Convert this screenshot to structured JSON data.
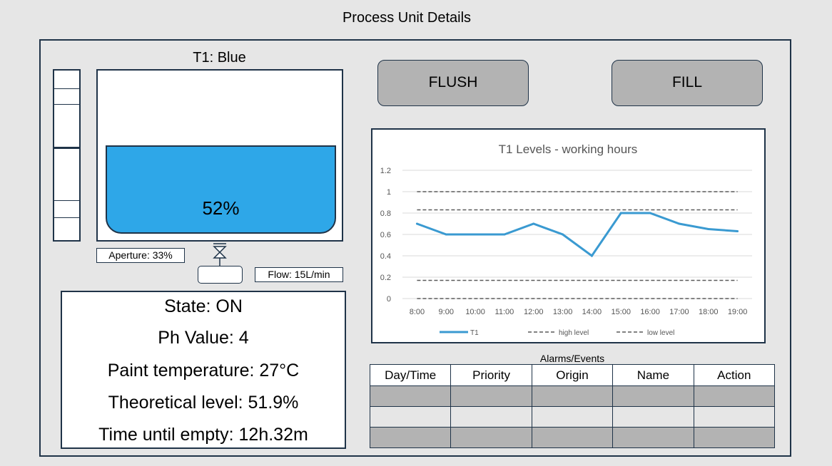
{
  "page": {
    "title": "Process Unit Details"
  },
  "tank": {
    "title": "T1: Blue",
    "fill_label": "52%",
    "fill_fraction": 0.52,
    "liquid_color": "#2ea7e8",
    "aperture_label": "Aperture: 33%",
    "flow_label": "Flow: 15L/min"
  },
  "info": {
    "state": "State: ON",
    "ph": "Ph Value: 4",
    "temperature": "Paint temperature: 27°C",
    "theoretical_level": "Theoretical level: 51.9%",
    "time_until_empty": "Time until empty: 12h.32m"
  },
  "buttons": {
    "flush": "FLUSH",
    "fill": "FILL"
  },
  "chart_data": {
    "type": "line",
    "title": "T1 Levels - working hours",
    "categories": [
      "8:00",
      "9:00",
      "10:00",
      "11:00",
      "12:00",
      "13:00",
      "14:00",
      "15:00",
      "16:00",
      "17:00",
      "18:00",
      "19:00"
    ],
    "yticks": [
      "0",
      "0.2",
      "0.4",
      "0.6",
      "0.8",
      "1",
      "1.2"
    ],
    "ylim": [
      0,
      1.2
    ],
    "grid": true,
    "legend_position": "bottom",
    "series": [
      {
        "name": "T1",
        "style": "solid",
        "color": "#3a9ad1",
        "values": [
          0.7,
          0.6,
          0.6,
          0.6,
          0.7,
          0.6,
          0.4,
          0.8,
          0.8,
          0.7,
          0.65,
          0.63
        ]
      },
      {
        "name": "high level",
        "style": "dashed",
        "color": "#5a5a5a",
        "values": [
          1,
          1,
          1,
          1,
          1,
          1,
          1,
          1,
          1,
          1,
          1,
          1
        ]
      },
      {
        "name": "high level",
        "style": "dashed",
        "color": "#5a5a5a",
        "values": [
          0.83,
          0.83,
          0.83,
          0.83,
          0.83,
          0.83,
          0.83,
          0.83,
          0.83,
          0.83,
          0.83,
          0.83
        ]
      },
      {
        "name": "low level",
        "style": "dashed",
        "color": "#5a5a5a",
        "values": [
          0.17,
          0.17,
          0.17,
          0.17,
          0.17,
          0.17,
          0.17,
          0.17,
          0.17,
          0.17,
          0.17,
          0.17
        ]
      },
      {
        "name": "low level",
        "style": "dashed",
        "color": "#5a5a5a",
        "values": [
          0,
          0,
          0,
          0,
          0,
          0,
          0,
          0,
          0,
          0,
          0,
          0
        ]
      }
    ],
    "legend": [
      {
        "label": "T1",
        "style": "solid",
        "color": "#3a9ad1"
      },
      {
        "label": "high level",
        "style": "dashed",
        "color": "#5a5a5a"
      },
      {
        "label": "low level",
        "style": "dashed",
        "color": "#5a5a5a"
      }
    ]
  },
  "alarms": {
    "caption": "Alarms/Events",
    "columns": [
      "Day/Time",
      "Priority",
      "Origin",
      "Name",
      "Action"
    ],
    "row_count": 3
  }
}
